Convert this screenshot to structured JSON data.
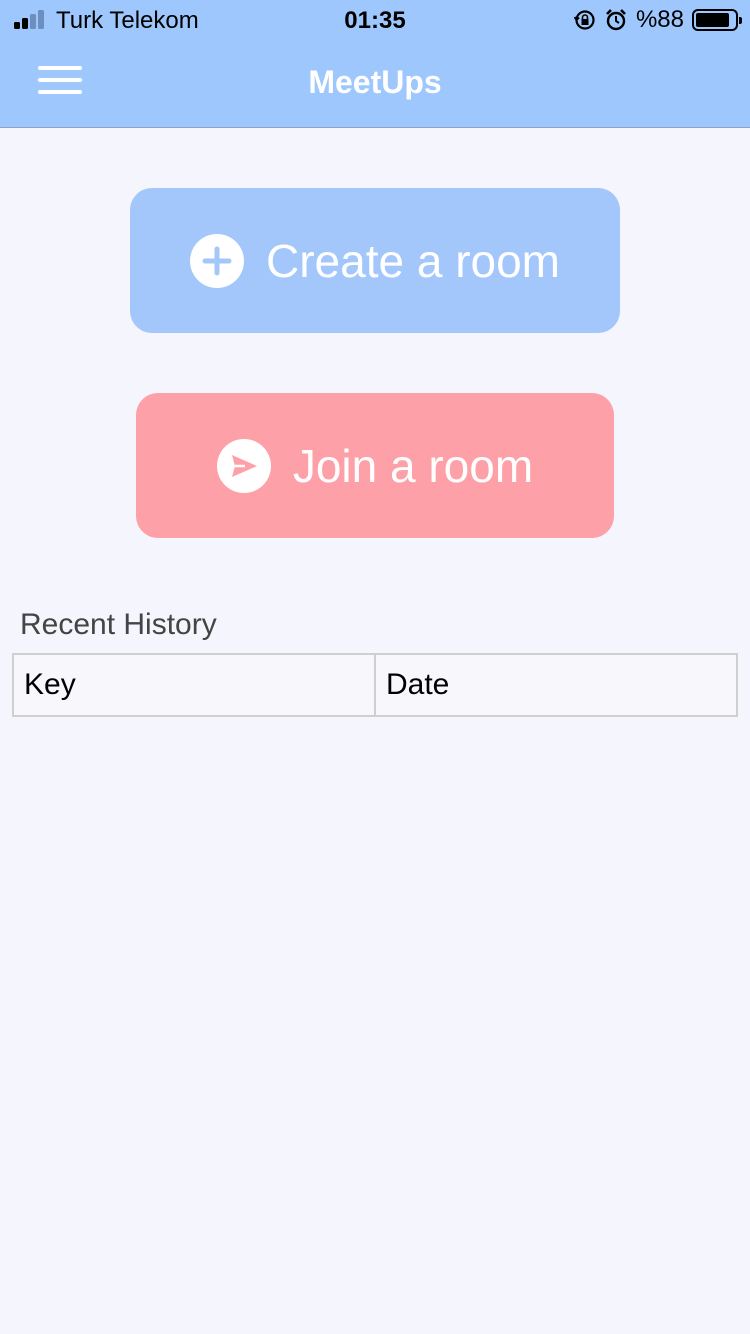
{
  "status_bar": {
    "carrier": "Turk Telekom",
    "time": "01:35",
    "battery_text": "%88",
    "battery_level": 0.88,
    "icons": [
      "signal-icon",
      "rotation-lock-icon",
      "alarm-icon",
      "battery-icon"
    ]
  },
  "header": {
    "title": "MeetUps",
    "menu_icon": "hamburger-menu-icon",
    "background": "#9ec8fd"
  },
  "actions": {
    "create_label": "Create a room",
    "create_icon": "plus-circle-icon",
    "create_color": "#a3c7fb",
    "join_label": "Join a room",
    "join_icon": "send-circle-icon",
    "join_color": "#fea0a8"
  },
  "history": {
    "title": "Recent History",
    "columns": [
      "Key",
      "Date"
    ],
    "rows": []
  }
}
